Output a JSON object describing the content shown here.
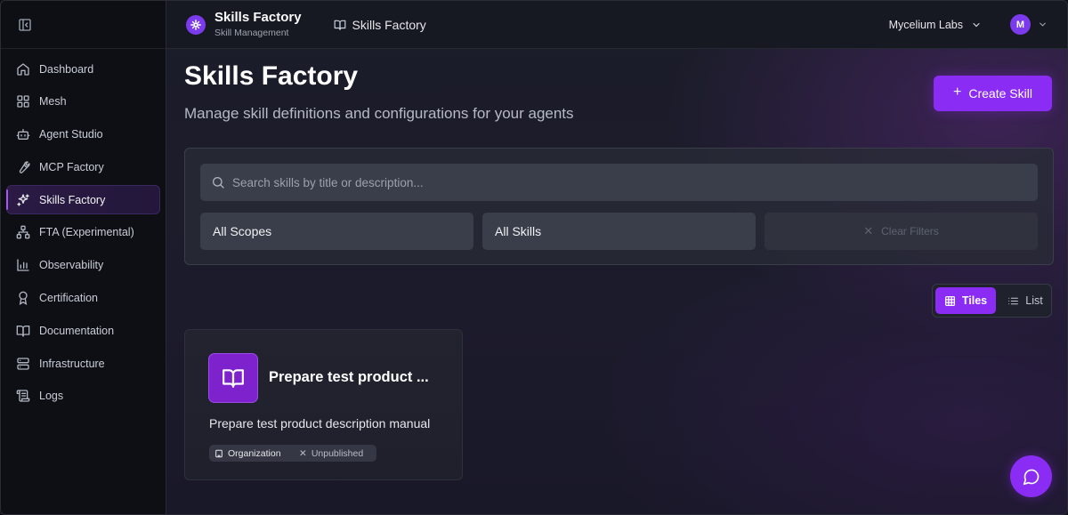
{
  "sidebar": {
    "items": [
      {
        "label": "Dashboard",
        "icon": "home-icon"
      },
      {
        "label": "Mesh",
        "icon": "grid-icon"
      },
      {
        "label": "Agent Studio",
        "icon": "bot-icon"
      },
      {
        "label": "MCP Factory",
        "icon": "wrench-icon"
      },
      {
        "label": "Skills Factory",
        "icon": "sparkles-icon",
        "active": true
      },
      {
        "label": "FTA (Experimental)",
        "icon": "network-icon"
      },
      {
        "label": "Observability",
        "icon": "bar-chart-icon"
      },
      {
        "label": "Certification",
        "icon": "award-icon"
      },
      {
        "label": "Documentation",
        "icon": "book-icon"
      },
      {
        "label": "Infrastructure",
        "icon": "server-icon"
      },
      {
        "label": "Logs",
        "icon": "scroll-icon"
      }
    ]
  },
  "header": {
    "brand_title": "Skills Factory",
    "brand_subtitle": "Skill Management",
    "breadcrumb": "Skills Factory",
    "org_name": "Mycelium Labs",
    "avatar_initial": "M"
  },
  "main": {
    "title": "Skills Factory",
    "subtitle": "Manage skill definitions and configurations for your agents",
    "create_button": "Create Skill",
    "search_placeholder": "Search skills by title or description...",
    "scope_filter": "All Scopes",
    "skill_filter": "All Skills",
    "clear_filters": "Clear Filters",
    "view": {
      "tiles": "Tiles",
      "list": "List",
      "selected": "Tiles"
    }
  },
  "cards": [
    {
      "title": "Prepare test product ...",
      "description": "Prepare test product description manual",
      "scope_badge": "Organization",
      "status_badge": "Unpublished"
    }
  ],
  "colors": {
    "accent": "#8b2cf5",
    "background": "#0f1117",
    "sidebar_bg": "#0d0f14"
  }
}
